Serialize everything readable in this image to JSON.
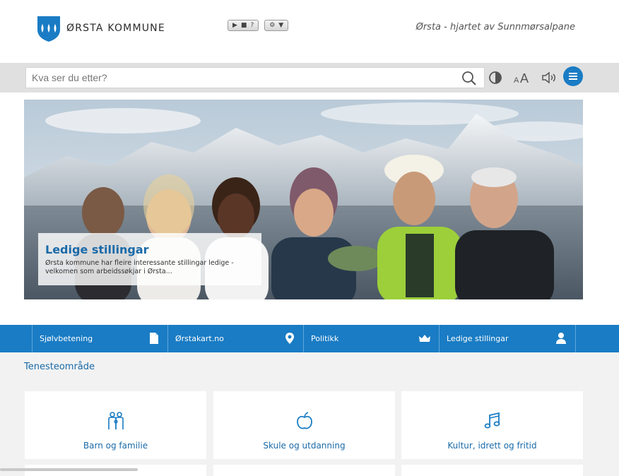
{
  "header": {
    "logo_text": "ØRSTA KOMMUNE",
    "tagline": "Ørsta - hjartet av Sunnmørsalpane",
    "player_buttons": [
      "▶",
      "■",
      "?"
    ],
    "settings_buttons": [
      "⚙",
      "▼"
    ]
  },
  "toolbar": {
    "search_placeholder": "Kva ser du etter?",
    "text_size_label": "AA"
  },
  "hero": {
    "title": "Ledige stillingar",
    "text": "Ørsta kommune har fleire interessante stillingar ledige - velkomen som arbeidssøkjar i Ørsta..."
  },
  "quicklinks": [
    {
      "label": "Sjølvbetening",
      "icon": "document-icon"
    },
    {
      "label": "Ørstakart.no",
      "icon": "map-pin-icon"
    },
    {
      "label": "Politikk",
      "icon": "crown-icon"
    },
    {
      "label": "Ledige stillingar",
      "icon": "person-icon"
    }
  ],
  "services": {
    "title": "Tenesteområde",
    "cards": [
      {
        "label": "Barn og familie",
        "icon": "family-icon"
      },
      {
        "label": "Skule og utdanning",
        "icon": "apple-icon"
      },
      {
        "label": "Kultur, idrett og fritid",
        "icon": "music-note-icon"
      }
    ]
  },
  "colors": {
    "brand_blue": "#1a7cc4",
    "link_blue": "#1a6aa8",
    "toolbar_grey": "#e0e0e0"
  }
}
